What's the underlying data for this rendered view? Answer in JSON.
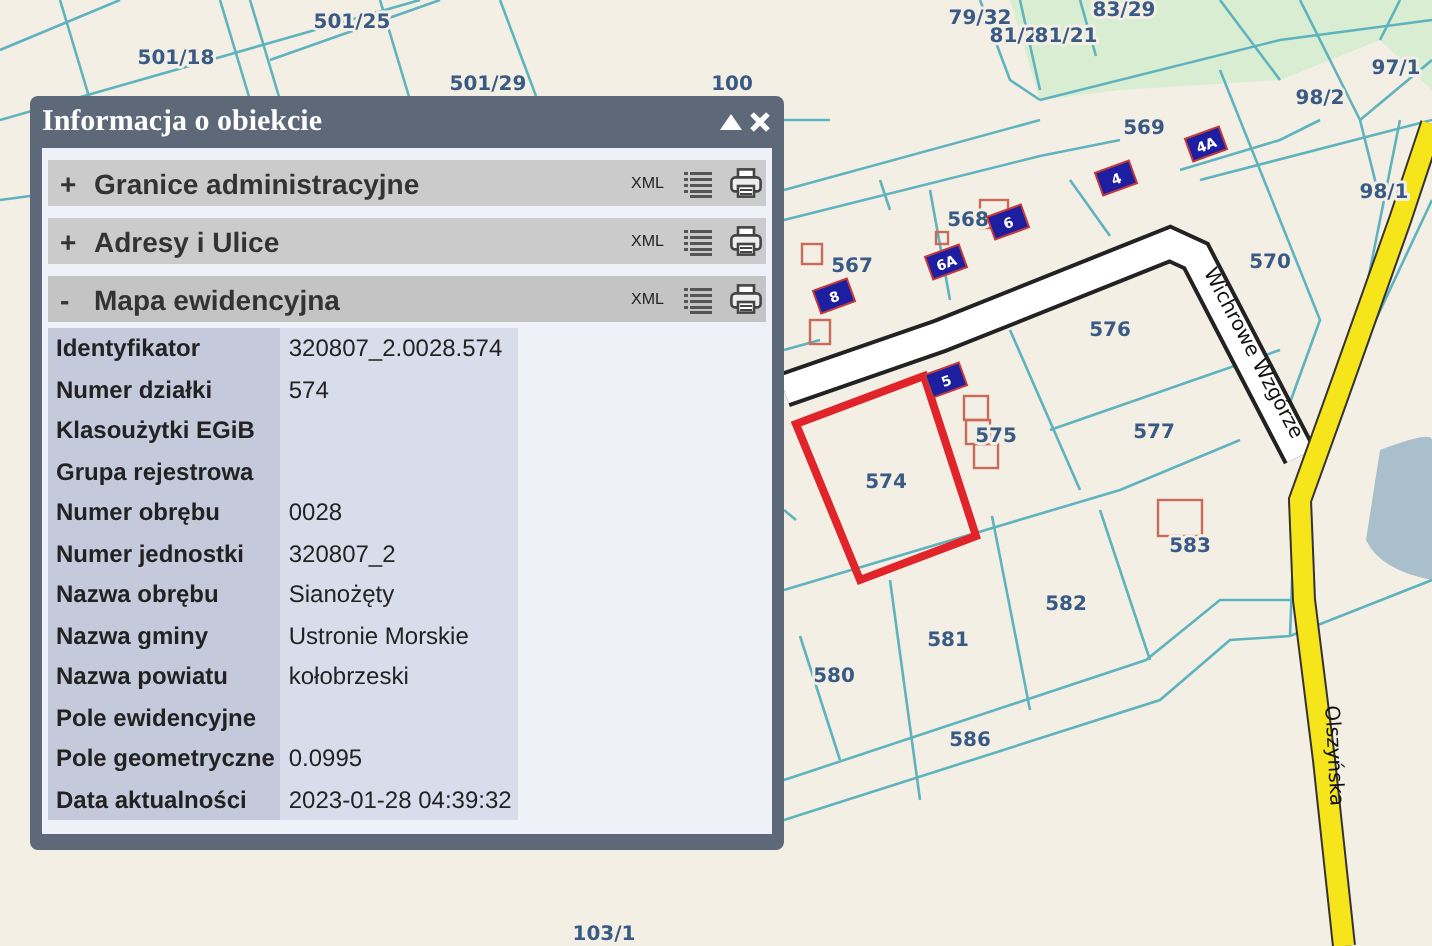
{
  "map": {
    "labels": [
      {
        "text": "501/25",
        "kind": "parcel"
      },
      {
        "text": "501/18",
        "kind": "parcel"
      },
      {
        "text": "501/29",
        "kind": "parcel"
      },
      {
        "text": "100",
        "kind": "parcel"
      },
      {
        "text": "79/32",
        "kind": "parcel"
      },
      {
        "text": "81/2",
        "kind": "parcel"
      },
      {
        "text": "81/21",
        "kind": "parcel"
      },
      {
        "text": "83/29",
        "kind": "parcel"
      },
      {
        "text": "97/1",
        "kind": "parcel"
      },
      {
        "text": "98/2",
        "kind": "parcel"
      },
      {
        "text": "98/1",
        "kind": "parcel"
      },
      {
        "text": "569",
        "kind": "parcel"
      },
      {
        "text": "568",
        "kind": "parcel"
      },
      {
        "text": "567",
        "kind": "parcel"
      },
      {
        "text": "570",
        "kind": "parcel"
      },
      {
        "text": "576",
        "kind": "parcel"
      },
      {
        "text": "577",
        "kind": "parcel"
      },
      {
        "text": "575",
        "kind": "parcel"
      },
      {
        "text": "574",
        "kind": "parcel"
      },
      {
        "text": "582",
        "kind": "parcel"
      },
      {
        "text": "581",
        "kind": "parcel"
      },
      {
        "text": "580",
        "kind": "parcel"
      },
      {
        "text": "586",
        "kind": "parcel"
      },
      {
        "text": "583",
        "kind": "parcel"
      },
      {
        "text": "103/1",
        "kind": "parcel"
      },
      {
        "text": "4A",
        "kind": "building"
      },
      {
        "text": "4",
        "kind": "building"
      },
      {
        "text": "6",
        "kind": "building"
      },
      {
        "text": "6A",
        "kind": "building"
      },
      {
        "text": "8",
        "kind": "building"
      },
      {
        "text": "5",
        "kind": "building"
      },
      {
        "text": "Wichrowe Wzgórze",
        "kind": "street"
      },
      {
        "text": "Olszyńska",
        "kind": "street"
      }
    ]
  },
  "panel": {
    "title": "Informacja o obiekcie",
    "sections": [
      {
        "label": "Granice administracyjne",
        "toggle": "+",
        "format": "XML"
      },
      {
        "label": "Adresy i Ulice",
        "toggle": "+",
        "format": "XML"
      },
      {
        "label": "Mapa ewidencyjna",
        "toggle": "-",
        "format": "XML",
        "rows": [
          {
            "label": "Identyfikator",
            "value": "320807_2.0028.574"
          },
          {
            "label": "Numer działki",
            "value": "574"
          },
          {
            "label": "Klasoużytki EGiB"
          },
          {
            "label": "Grupa rejestrowa"
          },
          {
            "label": "Numer obrębu",
            "value": "0028"
          },
          {
            "label": "Numer jednostki",
            "value": "320807_2"
          },
          {
            "label": "Nazwa obrębu",
            "value": "Sianożęty"
          },
          {
            "label": "Nazwa gminy",
            "value": "Ustronie Morskie"
          },
          {
            "label": "Nazwa powiatu",
            "value": "kołobrzeski"
          },
          {
            "label": "Pole ewidencyjne"
          },
          {
            "label": "Pole geometryczne",
            "value": "0.0995"
          },
          {
            "label": "Data aktualności",
            "value": "2023-01-28 04:39:32"
          }
        ]
      }
    ]
  }
}
